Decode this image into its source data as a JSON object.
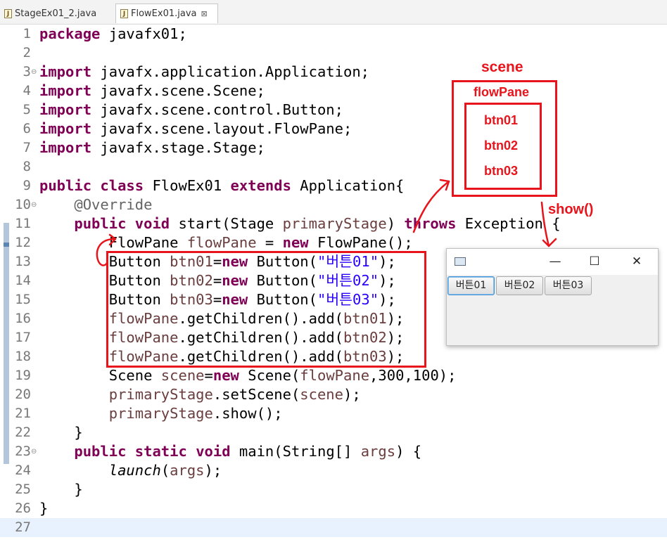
{
  "tabs": [
    {
      "label": "StageEx01_2.java",
      "icon": "java-file-icon"
    },
    {
      "label": "FlowEx01.java",
      "icon": "java-file-icon",
      "active": true,
      "close": "⊠"
    }
  ],
  "editor": {
    "lines": [
      {
        "n": "1",
        "html": "<span class=\"kw\">package</span> javafx01;"
      },
      {
        "n": "2",
        "html": ""
      },
      {
        "n": "3",
        "html": "<span class=\"kw\">import</span> javafx.application.Application;",
        "fold": "⊖"
      },
      {
        "n": "4",
        "html": "<span class=\"kw\">import</span> javafx.scene.Scene;"
      },
      {
        "n": "5",
        "html": "<span class=\"kw\">import</span> javafx.scene.control.Button;"
      },
      {
        "n": "6",
        "html": "<span class=\"kw\">import</span> javafx.scene.layout.FlowPane;"
      },
      {
        "n": "7",
        "html": "<span class=\"kw\">import</span> javafx.stage.Stage;"
      },
      {
        "n": "8",
        "html": ""
      },
      {
        "n": "9",
        "html": "<span class=\"kw\">public</span> <span class=\"kw\">class</span> FlowEx01 <span class=\"kw\">extends</span> Application{"
      },
      {
        "n": "10",
        "html": "    <span class=\"ann\">@Override</span>",
        "fold": "⊖"
      },
      {
        "n": "11",
        "html": "    <span class=\"kw\">public</span> <span class=\"kw\">void</span> start(Stage <span class=\"fld\">primaryStage</span>) <span class=\"kw\">throws</span> Exception {"
      },
      {
        "n": "12",
        "html": "        FlowPane <span class=\"fld\">flowPane</span> = <span class=\"kw\">new</span> FlowPane();"
      },
      {
        "n": "13",
        "html": "        Button <span class=\"fld\">btn01</span>=<span class=\"kw\">new</span> Button(<span class=\"str\">\"버튼01\"</span>);"
      },
      {
        "n": "14",
        "html": "        Button <span class=\"fld\">btn02</span>=<span class=\"kw\">new</span> Button(<span class=\"str\">\"버튼02\"</span>);"
      },
      {
        "n": "15",
        "html": "        Button <span class=\"fld\">btn03</span>=<span class=\"kw\">new</span> Button(<span class=\"str\">\"버튼03\"</span>);"
      },
      {
        "n": "16",
        "html": "        <span class=\"fld\">flowPane</span>.getChildren().add(<span class=\"fld\">btn01</span>);"
      },
      {
        "n": "17",
        "html": "        <span class=\"fld\">flowPane</span>.getChildren().add(<span class=\"fld\">btn02</span>);"
      },
      {
        "n": "18",
        "html": "        <span class=\"fld\">flowPane</span>.getChildren().add(<span class=\"fld\">btn03</span>);"
      },
      {
        "n": "19",
        "html": "        Scene <span class=\"fld\">scene</span>=<span class=\"kw\">new</span> Scene(<span class=\"fld\">flowPane</span>,300,100);"
      },
      {
        "n": "20",
        "html": "        <span class=\"fld\">primaryStage</span>.setScene(<span class=\"fld\">scene</span>);"
      },
      {
        "n": "21",
        "html": "        <span class=\"fld\">primaryStage</span>.show();"
      },
      {
        "n": "22",
        "html": "    }"
      },
      {
        "n": "23",
        "html": "    <span class=\"kw\">public</span> <span class=\"kw\">static</span> <span class=\"kw\">void</span> main(String[] <span class=\"fld\">args</span>) {",
        "fold": "⊖"
      },
      {
        "n": "24",
        "html": "        <span class=\"it\">launch</span>(<span class=\"fld\">args</span>);"
      },
      {
        "n": "25",
        "html": "    }"
      },
      {
        "n": "26",
        "html": "}"
      },
      {
        "n": "27",
        "html": "",
        "current": true
      }
    ]
  },
  "annotation": {
    "scene_label": "scene",
    "flowpane_label": "flowPane",
    "buttons": [
      "btn01",
      "btn02",
      "btn03"
    ],
    "show_label": "show()",
    "color": "#e8141c"
  },
  "fx_window": {
    "title_icon": "java-app-icon",
    "minimize": "—",
    "maximize": "☐",
    "close": "✕",
    "buttons": [
      "버튼01",
      "버튼02",
      "버튼03"
    ],
    "focused_index": 0
  }
}
